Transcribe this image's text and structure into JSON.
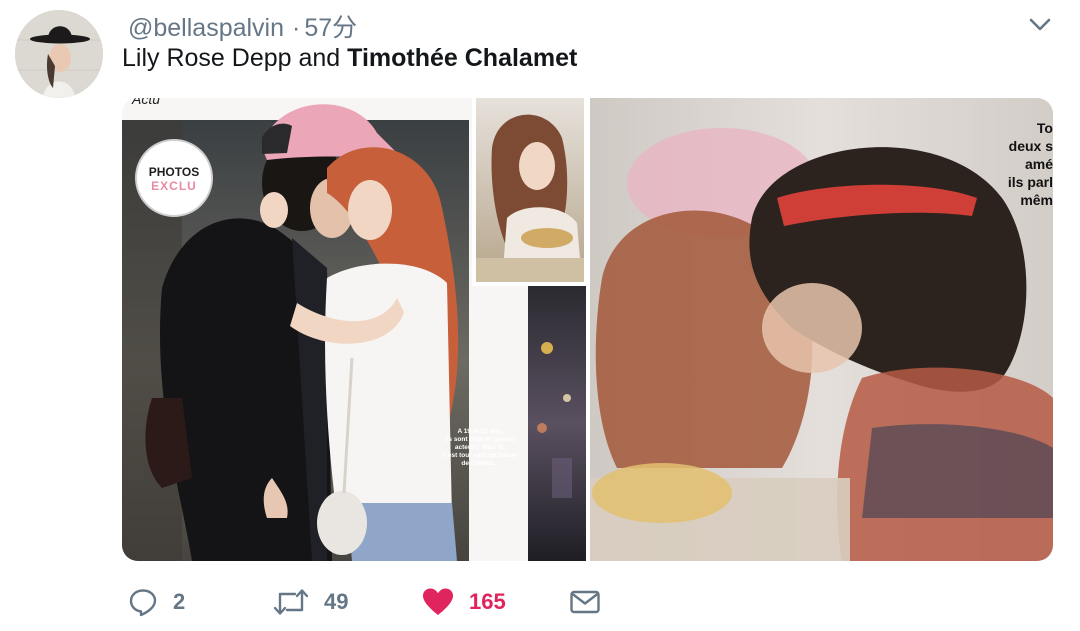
{
  "tweet": {
    "handle": "@bellaspalvin",
    "separator": "·",
    "time": "57分",
    "text_plain": "Lily Rose Depp and ",
    "text_bold": "Timothée Chalamet"
  },
  "media": {
    "badge_line1": "PHOTOS",
    "badge_line2": "EXCLU",
    "top_fragment": "Actu",
    "caption_lines": [
      "A 19 et 22 ans,",
      "ils sont déjà de grands",
      "acteurs. Mais là,",
      "c'est tout sauf un baiser",
      "de cinéma..."
    ],
    "right_text_lines": [
      "To",
      "deux s",
      "amé",
      "ils parl",
      "mêm"
    ]
  },
  "actions": {
    "reply_count": "2",
    "retweet_count": "49",
    "like_count": "165"
  },
  "colors": {
    "muted": "#657786",
    "text": "#14171a",
    "like": "#e0245e"
  },
  "icons": [
    "chevron-down-icon",
    "reply-icon",
    "retweet-icon",
    "heart-icon",
    "dm-icon"
  ]
}
